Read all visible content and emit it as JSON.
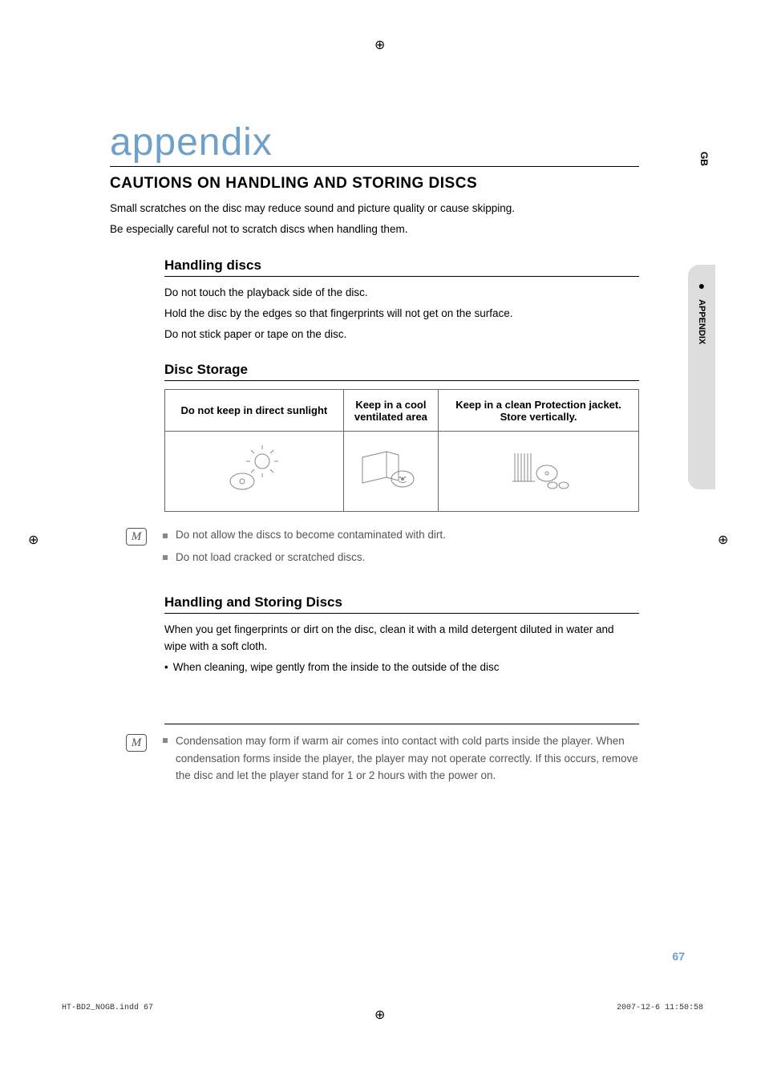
{
  "reg_mark": "⊕",
  "side": {
    "lang": "GB",
    "section": "APPENDIX"
  },
  "title": "appendix",
  "heading": "CAUTIONS ON HANDLING AND STORING DISCS",
  "intro": {
    "line1": "Small scratches on the disc may reduce sound and picture quality or cause skipping.",
    "line2": "Be especially careful not to scratch discs when handling them."
  },
  "handling": {
    "title": "Handling discs",
    "line1": "Do not touch the playback side of the disc.",
    "line2": "Hold the disc by the edges so that fingerprints will not get on the surface.",
    "line3": "Do not stick paper or tape on the disc."
  },
  "storage": {
    "title": "Disc Storage",
    "cells": {
      "c1": "Do not keep in direct sunlight",
      "c2a": "Keep in a cool",
      "c2b": "ventilated area",
      "c3a": "Keep in a clean Protection jacket.",
      "c3b": "Store vertically."
    }
  },
  "note1": {
    "item1": "Do not allow the discs to become contaminated with dirt.",
    "item2": "Do not load cracked or scratched discs."
  },
  "handling_storing": {
    "title": "Handling and Storing Discs",
    "p1": "When you get fingerprints or dirt on the disc, clean it with a mild detergent diluted in water and wipe with a soft cloth.",
    "bullet1": "When cleaning, wipe gently from the inside to the outside of the disc"
  },
  "note2": {
    "text": "Condensation may form if warm air comes into contact with cold parts inside the player. When condensation forms inside the player, the player may not operate correctly. If this occurs, remove the disc and let the player stand for 1 or 2 hours with the power on."
  },
  "page_number": "67",
  "footer": {
    "left": "HT-BD2_NOGB.indd   67",
    "right": "2007-12-6   11:50:58"
  }
}
